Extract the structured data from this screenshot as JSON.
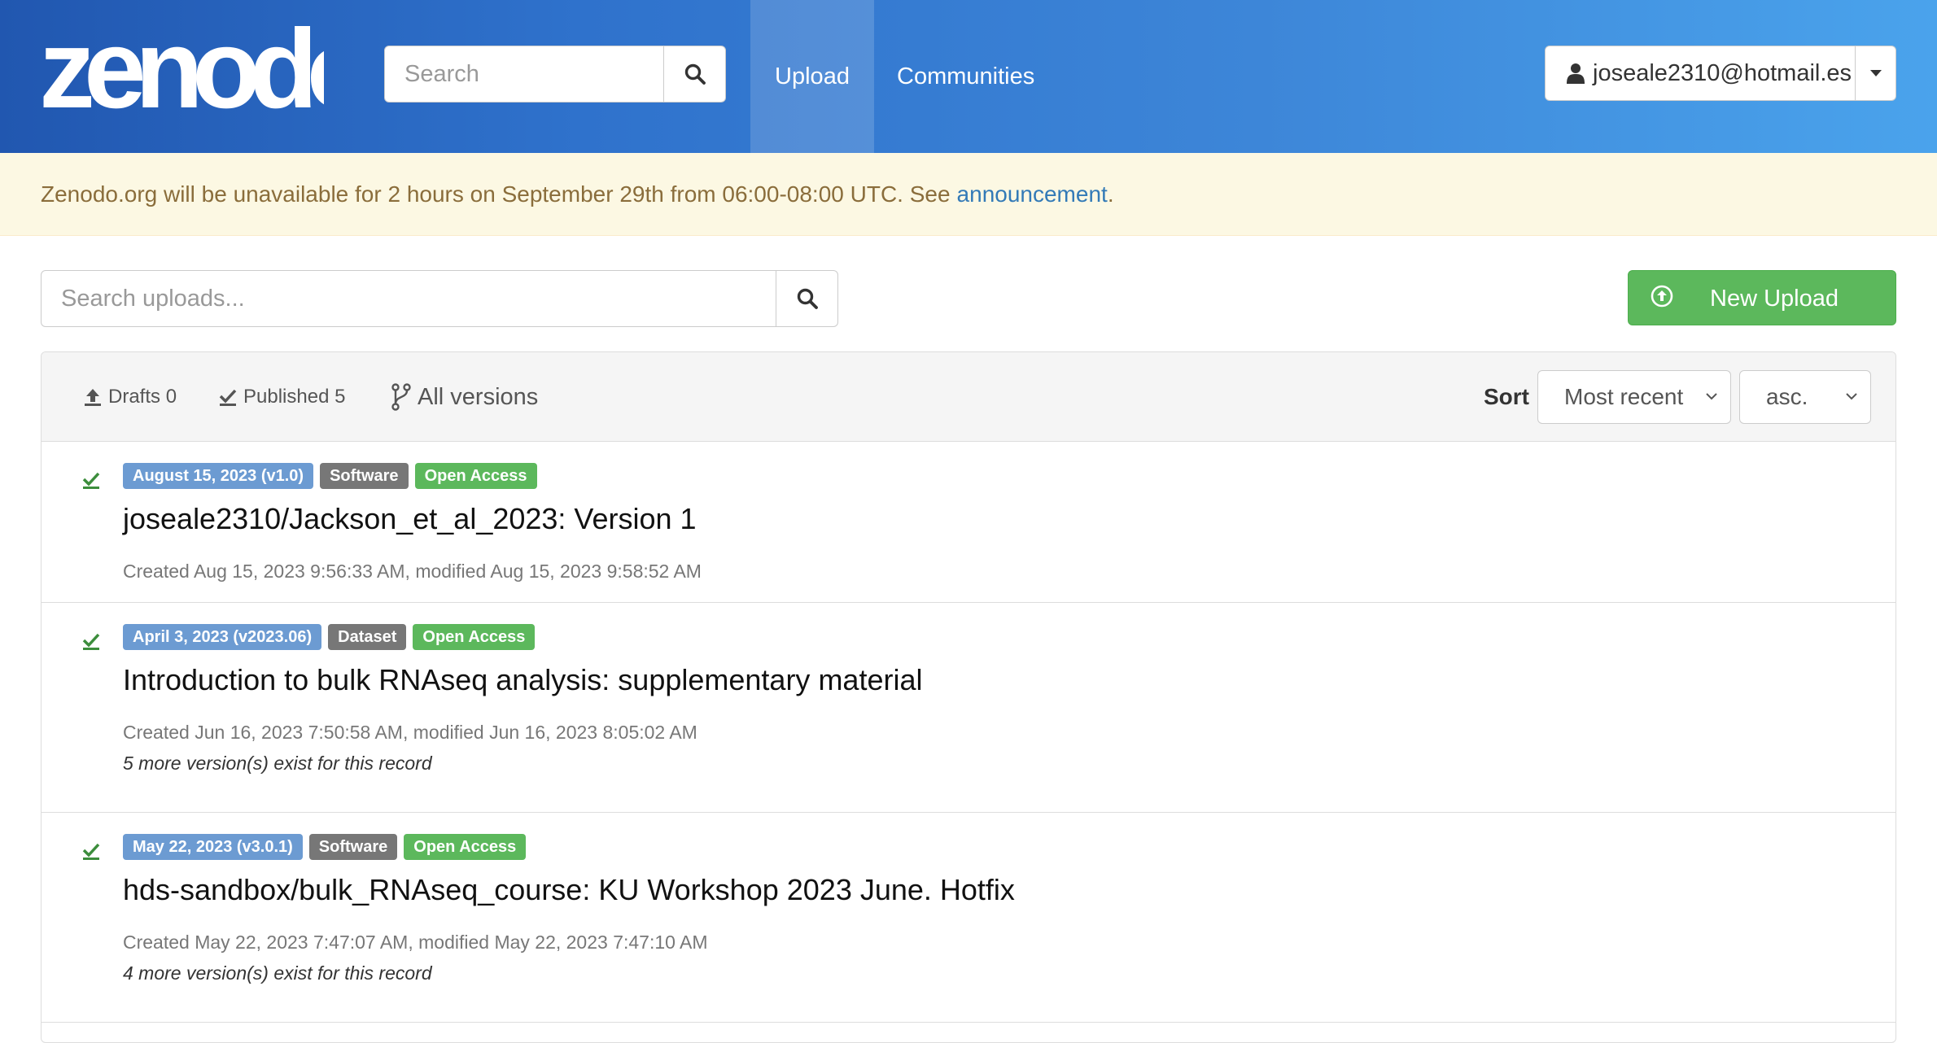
{
  "header": {
    "logo_text": "zenodo",
    "search_placeholder": "Search",
    "nav": {
      "upload": "Upload",
      "communities": "Communities"
    },
    "user_email": "joseale2310@hotmail.es",
    "icons": {
      "search": "search-icon",
      "user": "user-icon",
      "caret": "caret-down-icon"
    }
  },
  "announcement": {
    "text": "Zenodo.org will be unavailable for 2 hours on September 29th from 06:00-08:00 UTC. See",
    "link_text": "announcement",
    "suffix": "."
  },
  "toolbar": {
    "search_placeholder": "Search uploads...",
    "new_upload_label": "New Upload"
  },
  "filters": {
    "drafts_label": "Drafts",
    "drafts_count": "0",
    "published_label": "Published",
    "published_count": "5",
    "versions_label": "All versions"
  },
  "sort": {
    "label": "Sort",
    "field": "Most recent",
    "order": "asc."
  },
  "records": [
    {
      "date_badge": "August 15, 2023 (v1.0)",
      "type_badge": "Software",
      "access_badge": "Open Access",
      "title": "joseale2310/Jackson_et_al_2023: Version 1",
      "meta": "Created Aug 15, 2023 9:56:33 AM, modified Aug 15, 2023 9:58:52 AM",
      "versions_note": ""
    },
    {
      "date_badge": "April 3, 2023 (v2023.06)",
      "type_badge": "Dataset",
      "access_badge": "Open Access",
      "title": "Introduction to bulk RNAseq analysis: supplementary material",
      "meta": "Created Jun 16, 2023 7:50:58 AM, modified Jun 16, 2023 8:05:02 AM",
      "versions_note": "5 more version(s) exist for this record"
    },
    {
      "date_badge": "May 22, 2023 (v3.0.1)",
      "type_badge": "Software",
      "access_badge": "Open Access",
      "title": "hds-sandbox/bulk_RNAseq_course: KU Workshop 2023 June. Hotfix",
      "meta": "Created May 22, 2023 7:47:07 AM, modified May 22, 2023 7:47:10 AM",
      "versions_note": "4 more version(s) exist for this record"
    }
  ],
  "colors": {
    "header_start": "#2157b0",
    "header_end": "#4aa3ec",
    "date_badge": "#6c9bd2",
    "type_badge": "#777777",
    "open_access": "#5cb85c",
    "new_upload": "#5cb85c",
    "announcement_bg": "#fcf8e3",
    "link": "#337ab7"
  }
}
